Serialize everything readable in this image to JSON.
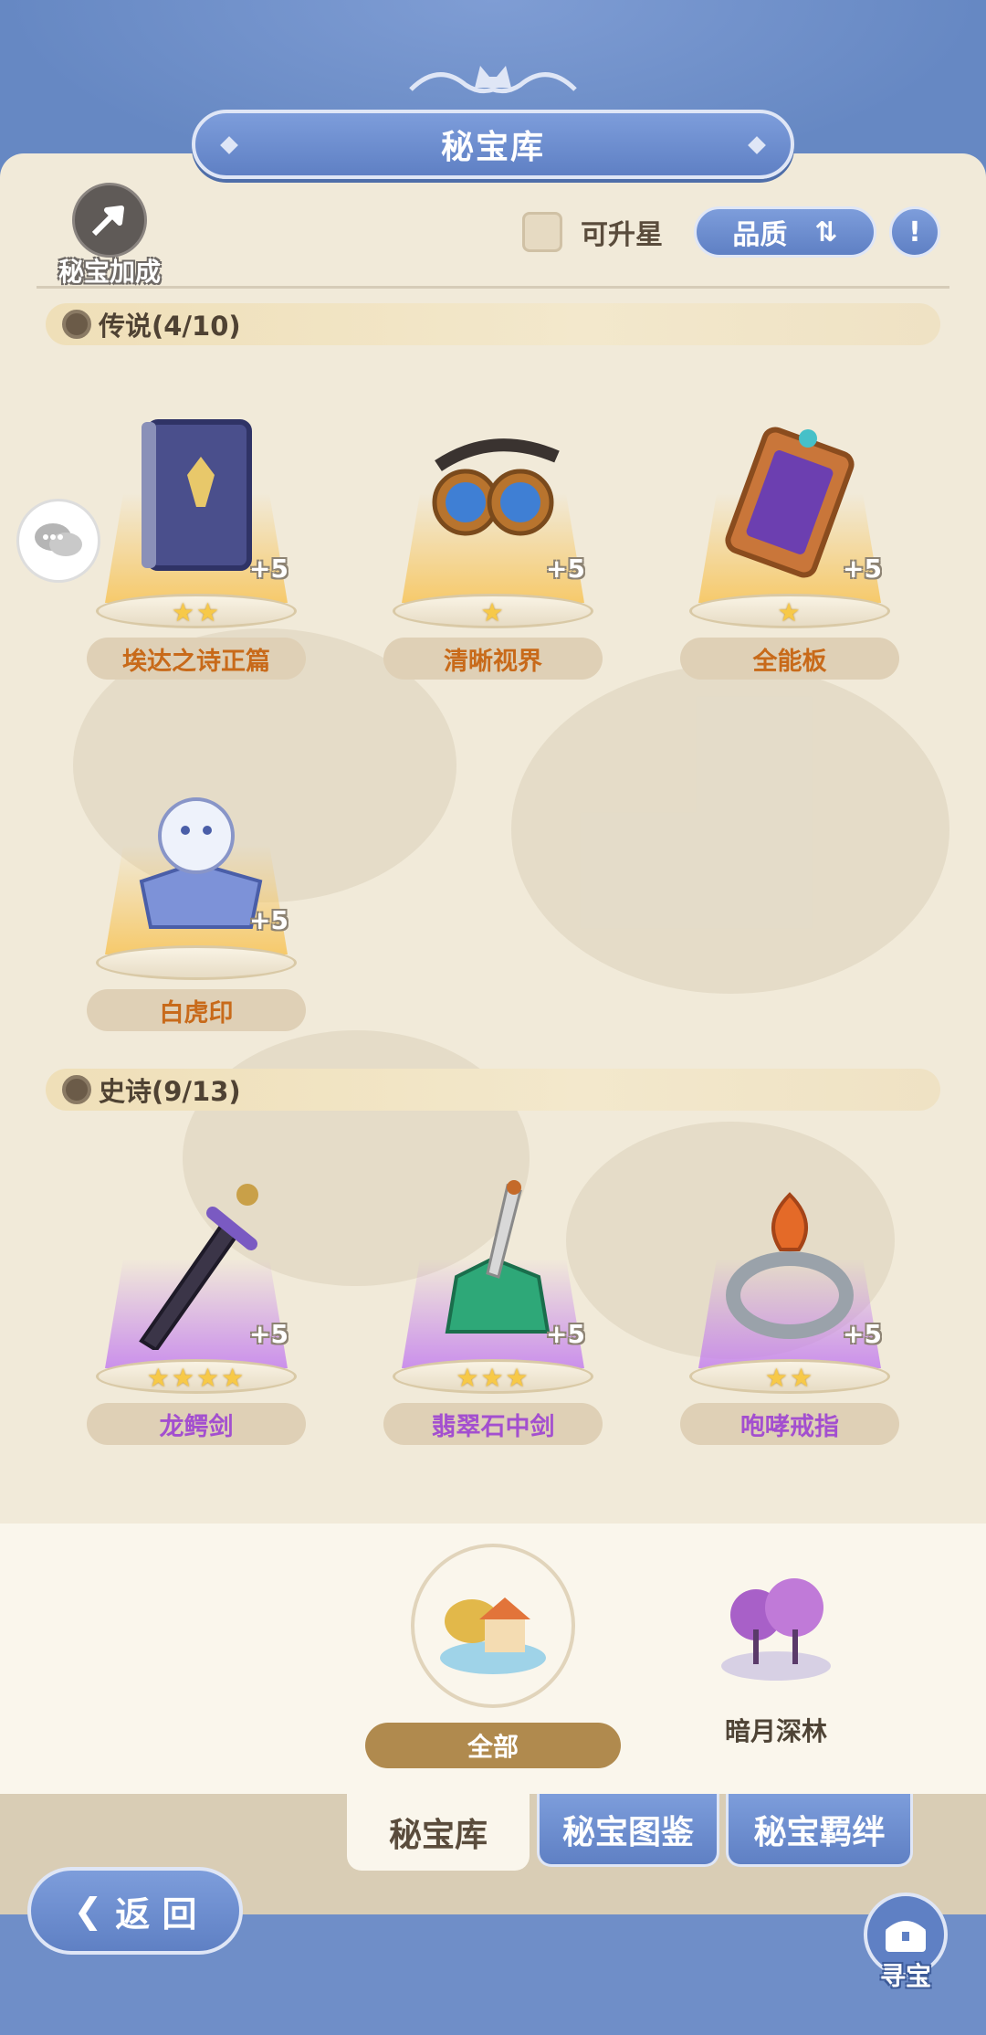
{
  "header": {
    "title": "秘宝库"
  },
  "bonus": {
    "label": "秘宝加成",
    "icon": "bonus-arrow-icon"
  },
  "filters": {
    "upstar_label": "可升星",
    "quality_label": "品质"
  },
  "sections": [
    {
      "title": "传说(4/10)",
      "rarity": "legendary",
      "items": [
        {
          "name": "埃达之诗正篇",
          "stars": "★★",
          "plus": "+5",
          "icon": "book-icon"
        },
        {
          "name": "清晰视界",
          "stars": "★",
          "plus": "+5",
          "icon": "goggles-icon"
        },
        {
          "name": "全能板",
          "stars": "★",
          "plus": "+5",
          "icon": "tablet-icon"
        },
        {
          "name": "白虎印",
          "stars": "",
          "plus": "+5",
          "icon": "tiger-statue-icon"
        }
      ]
    },
    {
      "title": "史诗(9/13)",
      "rarity": "epic",
      "items": [
        {
          "name": "龙鳄剑",
          "stars": "★★★★",
          "plus": "+5",
          "icon": "sword-icon"
        },
        {
          "name": "翡翠石中剑",
          "stars": "★★★",
          "plus": "+5",
          "icon": "emerald-sword-icon"
        },
        {
          "name": "咆哮戒指",
          "stars": "★★",
          "plus": "+5",
          "icon": "ring-icon"
        }
      ]
    }
  ],
  "regions": {
    "all_label": "全部",
    "forest_label": "暗月深林"
  },
  "tabs": {
    "library": "秘宝库",
    "compendium": "秘宝图鉴",
    "bond": "秘宝羁绊"
  },
  "footer": {
    "back_label": "返 回",
    "treasure_label": "寻宝"
  },
  "colors": {
    "gold_glow": "#f7c448",
    "purple_glow": "#c480ee",
    "panel_blue": "#6f8ec8"
  }
}
